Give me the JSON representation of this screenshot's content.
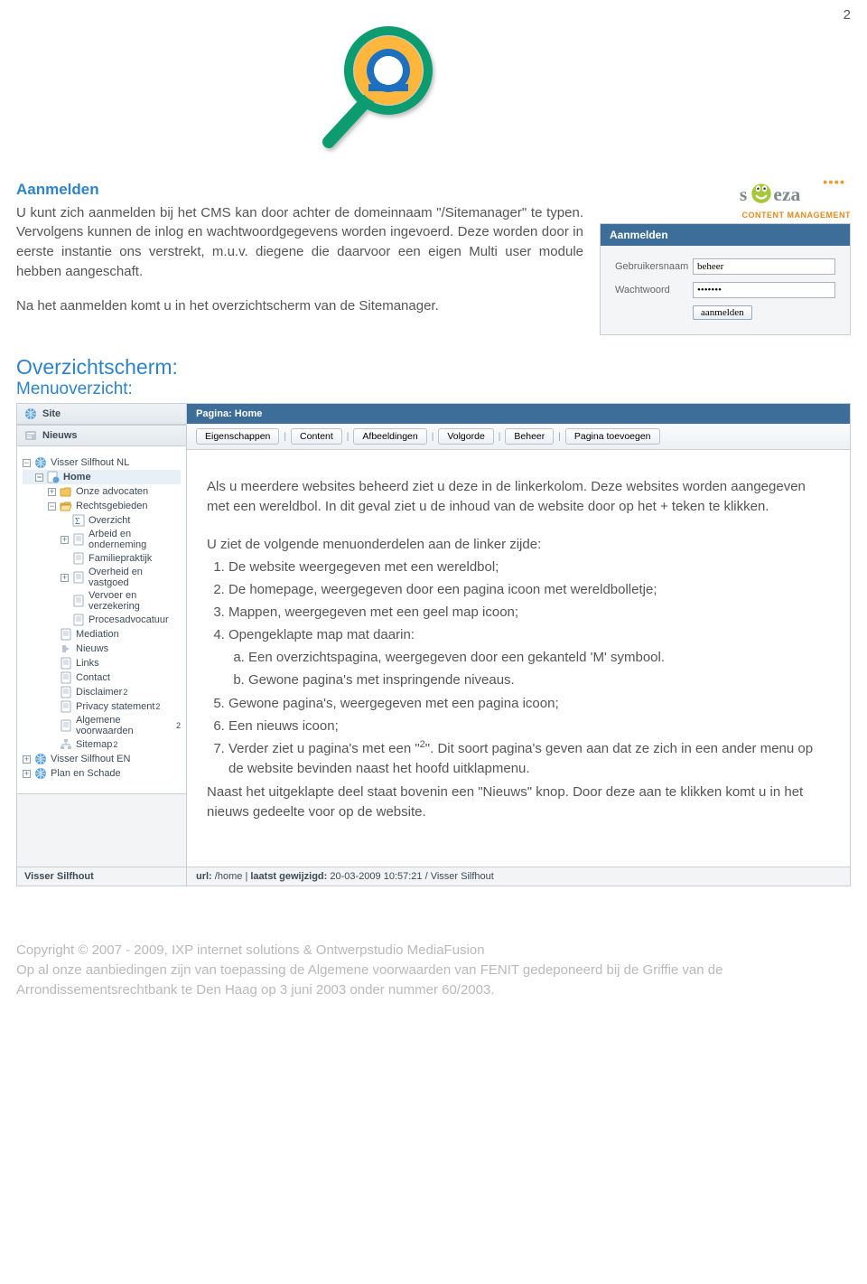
{
  "page_number": "2",
  "intro": {
    "heading": "Aanmelden",
    "p1": "U kunt zich aanmelden bij het CMS kan door achter de domeinnaam \"/Sitemanager\" te typen. Vervolgens kunnen de inlog en wachtwoordgegevens worden ingevoerd. Deze worden door in eerste instantie ons verstrekt, m.u.v. diegene die daarvoor een eigen Multi user module hebben aangeschaft.",
    "p2": "Na het aanmelden komt u in het overzichtscherm van de Sitemanager."
  },
  "brand": {
    "name": "speza",
    "sub": "CONTENT MANAGEMENT"
  },
  "login": {
    "header": "Aanmelden",
    "user_label": "Gebruikersnaam",
    "user_value": "beheer",
    "pass_label": "Wachtwoord",
    "pass_value": "•••••••",
    "button": "aanmelden"
  },
  "sections": {
    "heading": "Overzichtscherm:",
    "sub": "Menuoverzicht:"
  },
  "sidebar": {
    "site_header": "Site",
    "news_header": "Nieuws",
    "tree": [
      {
        "depth": 1,
        "icon": "globe",
        "label": "Visser Silfhout NL",
        "toggle": "minus"
      },
      {
        "depth": 2,
        "icon": "page-globe",
        "label": "Home",
        "toggle": "minus",
        "selected": true
      },
      {
        "depth": 3,
        "icon": "folder",
        "label": "Onze advocaten",
        "toggle": "plus"
      },
      {
        "depth": 3,
        "icon": "folder-open",
        "label": "Rechtsgebieden",
        "toggle": "minus"
      },
      {
        "depth": 4,
        "icon": "sigma",
        "label": "Overzicht"
      },
      {
        "depth": 4,
        "icon": "page",
        "label": "Arbeid en onderneming",
        "toggle": "plus"
      },
      {
        "depth": 4,
        "icon": "page",
        "label": "Familiepraktijk"
      },
      {
        "depth": 4,
        "icon": "page",
        "label": "Overheid en vastgoed",
        "toggle": "plus"
      },
      {
        "depth": 4,
        "icon": "page",
        "label": "Vervoer en verzekering"
      },
      {
        "depth": 4,
        "icon": "page",
        "label": "Procesadvocatuur"
      },
      {
        "depth": 3,
        "icon": "page",
        "label": "Mediation"
      },
      {
        "depth": 3,
        "icon": "news",
        "label": "Nieuws"
      },
      {
        "depth": 3,
        "icon": "page",
        "label": "Links"
      },
      {
        "depth": 3,
        "icon": "page",
        "label": "Contact"
      },
      {
        "depth": 3,
        "icon": "page",
        "label": "Disclaimer",
        "sup": "2"
      },
      {
        "depth": 3,
        "icon": "page",
        "label": "Privacy statement",
        "sup": "2"
      },
      {
        "depth": 3,
        "icon": "page",
        "label": "Algemene voorwaarden",
        "sup": "2"
      },
      {
        "depth": 3,
        "icon": "sitemap",
        "label": "Sitemap",
        "sup": "2"
      },
      {
        "depth": 1,
        "icon": "globe",
        "label": "Visser Silfhout EN",
        "toggle": "plus"
      },
      {
        "depth": 1,
        "icon": "globe",
        "label": "Plan en Schade",
        "toggle": "plus"
      }
    ]
  },
  "main": {
    "page_header": "Pagina: Home",
    "tabs": [
      "Eigenschappen",
      "Content",
      "Afbeeldingen",
      "Volgorde",
      "Beheer",
      "Pagina toevoegen"
    ],
    "sep": "|",
    "para1": "Als u meerdere websites beheerd ziet u deze in de linkerkolom. Deze websites worden aangegeven met een wereldbol. In dit geval ziet u de inhoud van de website door op het + teken te klikken.",
    "list_intro": "U ziet de volgende menuonderdelen aan de linker zijde:",
    "items": {
      "i1": "De website weergegeven met een wereldbol;",
      "i2": "De homepage, weergegeven door een pagina icoon met wereldbolletje;",
      "i3": "Mappen, weergegeven met een geel map icoon;",
      "i4": "Opengeklapte map mat daarin:",
      "i4a": "Een overzichtspagina, weergegeven door een gekanteld 'M' symbool.",
      "i4b": "Gewone pagina's met inspringende niveaus.",
      "i5": "Gewone pagina's, weergegeven met een pagina icoon;",
      "i6": "Een nieuws icoon;",
      "i7a": "Verder ziet u pagina's met een \"",
      "i7sup": "2",
      "i7b": "\". Dit soort pagina's geven aan dat ze zich in een ander menu op de website bevinden naast het hoofd uitklapmenu."
    },
    "para2": "Naast het uitgeklapte deel staat bovenin een \"Nieuws\" knop. Door deze aan te klikken komt u in het nieuws gedeelte voor op de website."
  },
  "appfooter": {
    "left": "Visser Silfhout",
    "url_label": "url:",
    "url_value": "/home",
    "mod_label": "laatst gewijzigd:",
    "mod": "20-03-2009 10:57:21 / Visser Silfhout"
  },
  "copyright": {
    "line1": "Copyright © 2007 - 2009, IXP internet solutions & Ontwerpstudio MediaFusion",
    "line2": "Op al onze aanbiedingen zijn van toepassing de Algemene voorwaarden van FENIT gedeponeerd bij de Griffie van de Arrondissementsrechtbank te Den Haag op 3 juni 2003 onder nummer 60/2003."
  }
}
